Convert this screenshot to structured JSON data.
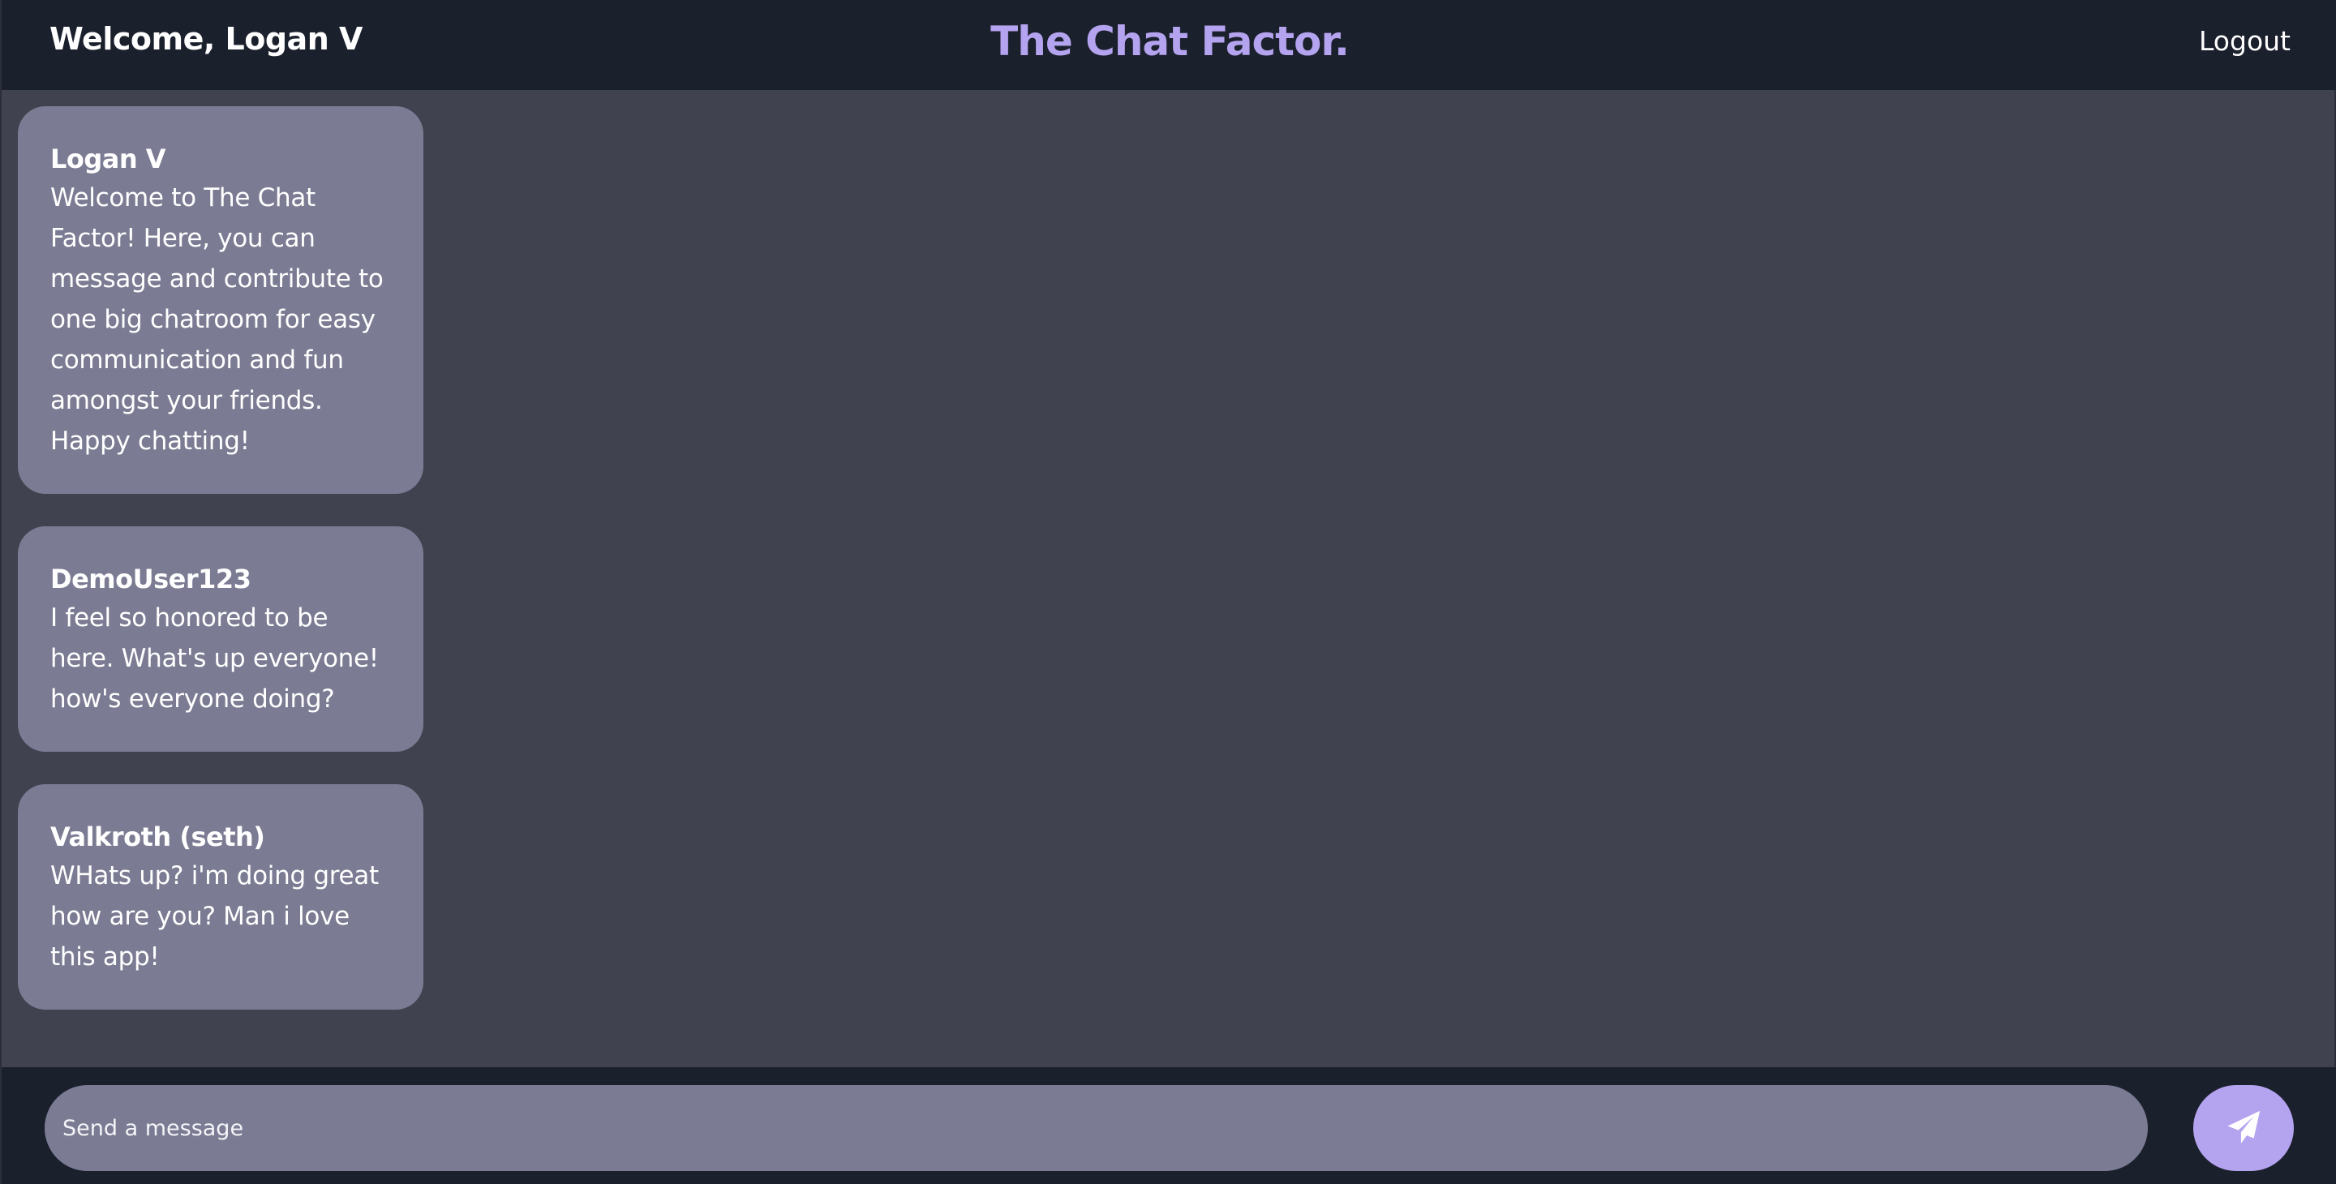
{
  "header": {
    "welcome": "Welcome, Logan V",
    "brand": "The Chat Factor.",
    "logout_label": "Logout"
  },
  "messages": [
    {
      "author": "Logan V",
      "text": "Welcome to The Chat Factor! Here, you can message and contribute to one big chatroom for easy communication and fun amongst your friends. Happy chatting!"
    },
    {
      "author": "DemoUser123",
      "text": "I feel so honored to be here. What's up everyone! how's everyone doing?"
    },
    {
      "author": "Valkroth (seth)",
      "text": "WHats up? i'm doing great how are you? Man i love this app!"
    }
  ],
  "composer": {
    "placeholder": "Send a message",
    "value": "",
    "send_icon": "paper-plane-icon"
  },
  "colors": {
    "header_bg": "#1b202d",
    "page_bg": "#40424f",
    "bubble_bg": "#7b7b93",
    "accent": "#b4a3ef"
  }
}
